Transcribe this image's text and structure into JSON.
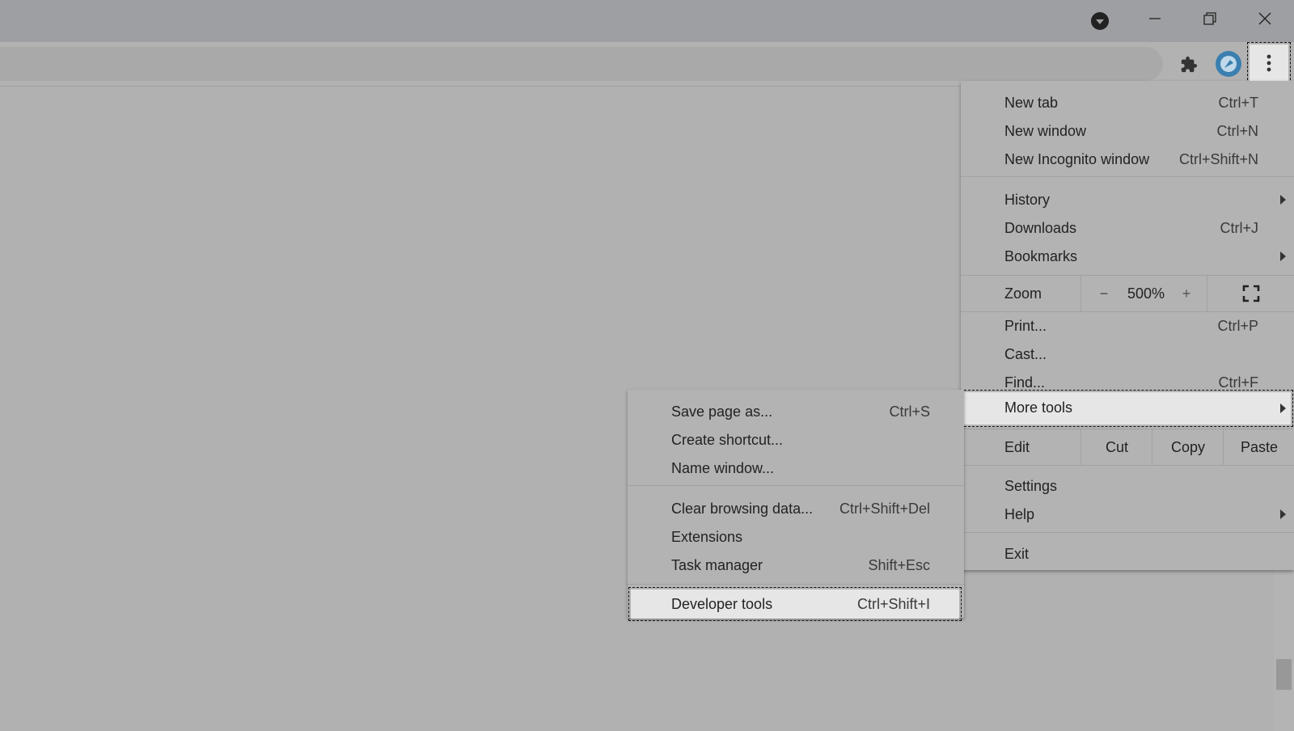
{
  "window": {
    "controls": {
      "minimize": "minimize-icon",
      "restore": "restore-icon",
      "close": "close-icon"
    }
  },
  "toolbar": {
    "extensions_icon": "puzzle-icon",
    "profile_icon": "avatar",
    "menu_icon": "kebab-icon"
  },
  "menu": {
    "new_tab": {
      "label": "New tab",
      "shortcut": "Ctrl+T"
    },
    "new_window": {
      "label": "New window",
      "shortcut": "Ctrl+N"
    },
    "new_incognito": {
      "label": "New Incognito window",
      "shortcut": "Ctrl+Shift+N"
    },
    "history": {
      "label": "History"
    },
    "downloads": {
      "label": "Downloads",
      "shortcut": "Ctrl+J"
    },
    "bookmarks": {
      "label": "Bookmarks"
    },
    "zoom": {
      "label": "Zoom",
      "minus": "−",
      "value": "500%",
      "plus": "+"
    },
    "print": {
      "label": "Print...",
      "shortcut": "Ctrl+P"
    },
    "cast": {
      "label": "Cast..."
    },
    "find": {
      "label": "Find...",
      "shortcut": "Ctrl+F"
    },
    "more_tools": {
      "label": "More tools"
    },
    "edit": {
      "label": "Edit",
      "cut": "Cut",
      "copy": "Copy",
      "paste": "Paste"
    },
    "settings": {
      "label": "Settings"
    },
    "help": {
      "label": "Help"
    },
    "exit": {
      "label": "Exit"
    }
  },
  "submenu": {
    "save_page": {
      "label": "Save page as...",
      "shortcut": "Ctrl+S"
    },
    "create_shortcut": {
      "label": "Create shortcut..."
    },
    "name_window": {
      "label": "Name window..."
    },
    "clear_data": {
      "label": "Clear browsing data...",
      "shortcut": "Ctrl+Shift+Del"
    },
    "extensions": {
      "label": "Extensions"
    },
    "task_manager": {
      "label": "Task manager",
      "shortcut": "Shift+Esc"
    },
    "dev_tools": {
      "label": "Developer tools",
      "shortcut": "Ctrl+Shift+I"
    }
  }
}
